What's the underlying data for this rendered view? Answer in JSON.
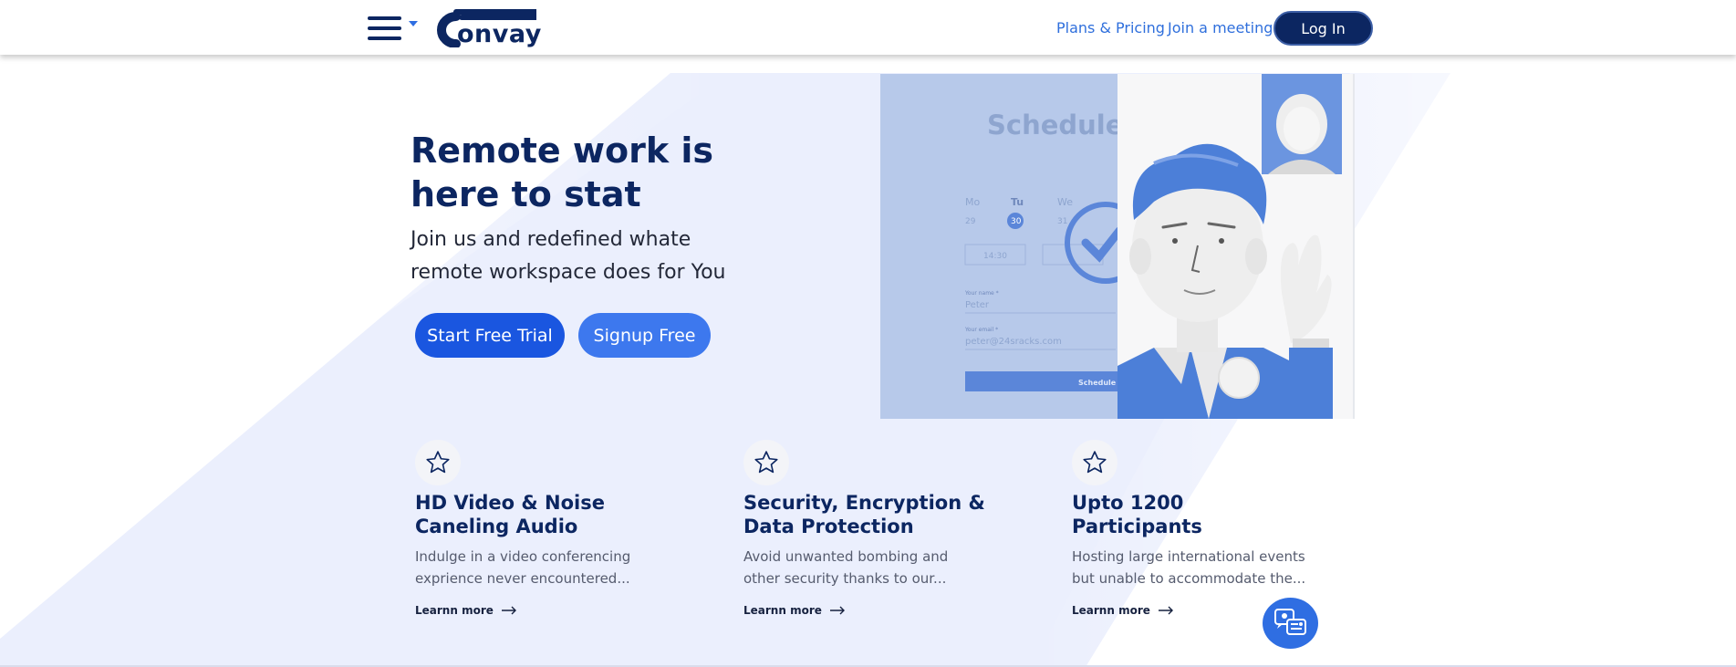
{
  "header": {
    "brand": "onvay",
    "nav": [
      {
        "label": "Plans & Pricing"
      },
      {
        "label": "Join a meeting"
      }
    ],
    "login_label": "Log In"
  },
  "hero": {
    "title": "Remote work is here to stat",
    "subtitle": "Join us and redefined whate remote workspace does for You",
    "cta_primary": "Start Free Trial",
    "cta_secondary": "Signup Free"
  },
  "illustration": {
    "heading": "Schedule a",
    "days": [
      "Mo",
      "Tu",
      "We"
    ],
    "dates": [
      "29",
      "30",
      "31"
    ],
    "time": "14:30",
    "name_label": "Your name *",
    "name_value": "Peter",
    "email_label": "Your email *",
    "email_value": "peter@24sracks.com",
    "submit": "Schedule f"
  },
  "features": [
    {
      "title": "HD Video & Noise Caneling Audio",
      "desc": "Indulge in a video conferencing exprience never encountered...",
      "link": "Learnn more"
    },
    {
      "title": "Security, Encryption & Data Protection",
      "desc": "Avoid unwanted bombing and other security thanks to our...",
      "link": "Learnn more"
    },
    {
      "title": "Upto 1200 Participants",
      "desc": "Hosting large international events but unable to accommodate the...",
      "link": "Learnn more"
    }
  ],
  "colors": {
    "brand_navy": "#0c2661",
    "accent_blue": "#2f6ee2",
    "primary_button": "#1a56e0",
    "secondary_button": "#3d78ee",
    "hero_bg": "#ebeffd"
  },
  "icons": [
    "menu-icon",
    "star-icon",
    "arrow-right-icon",
    "chat-icon"
  ]
}
